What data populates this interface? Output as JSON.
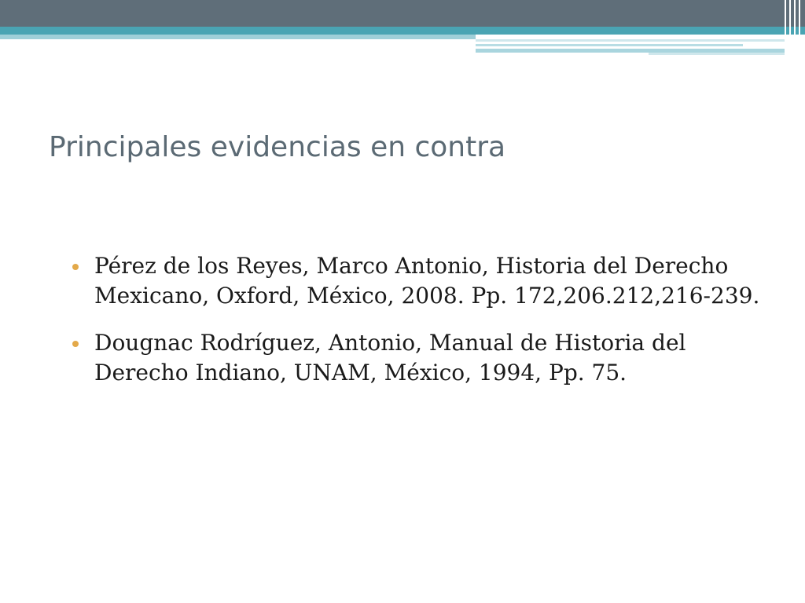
{
  "slide": {
    "title": "Principales evidencias en contra",
    "bullets": [
      "Pérez de los Reyes, Marco Antonio, Historia del Derecho Mexicano, Oxford, México, 2008. Pp. 172,206.212,216-239.",
      "Dougnac Rodríguez, Antonio, Manual de Historia del Derecho Indiano, UNAM, México, 1994, Pp. 75."
    ]
  },
  "colors": {
    "header_dark": "#5f6e79",
    "header_teal": "#4aa4b3",
    "title_text": "#5b6a74",
    "bullet_dot": "#e3a94a"
  }
}
